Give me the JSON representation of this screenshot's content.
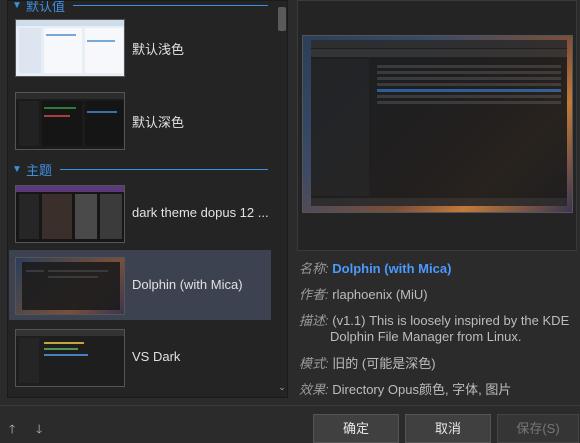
{
  "groups": [
    {
      "title": "默认值",
      "items": [
        {
          "label": "默认浅色"
        },
        {
          "label": "默认深色"
        }
      ]
    },
    {
      "title": "主题",
      "items": [
        {
          "label": "dark theme dopus 12 ..."
        },
        {
          "label": "Dolphin (with Mica)"
        },
        {
          "label": "VS Dark"
        }
      ]
    }
  ],
  "details": {
    "name_key": "名称:",
    "name": "Dolphin (with Mica)",
    "author_key": "作者:",
    "author": "rlaphoenix (MiU)",
    "desc_key": "描述:",
    "desc_line1": "(v1.1) This is loosely inspired by the KDE",
    "desc_line2": "Dolphin File Manager from Linux.",
    "mode_key": "模式:",
    "mode": "旧的 (可能是深色)",
    "effect_key": "效果:",
    "effect": "Directory Opus颜色, 字体, 图片"
  },
  "buttons": {
    "ok": "确定",
    "cancel": "取消",
    "save": "保存(S)"
  },
  "colors": {
    "accent": "#3f8fe0",
    "selection": "#3c4250",
    "name_link": "#4a9aff"
  },
  "icons": {
    "up": "arrow-up-icon",
    "down": "arrow-down-icon"
  }
}
